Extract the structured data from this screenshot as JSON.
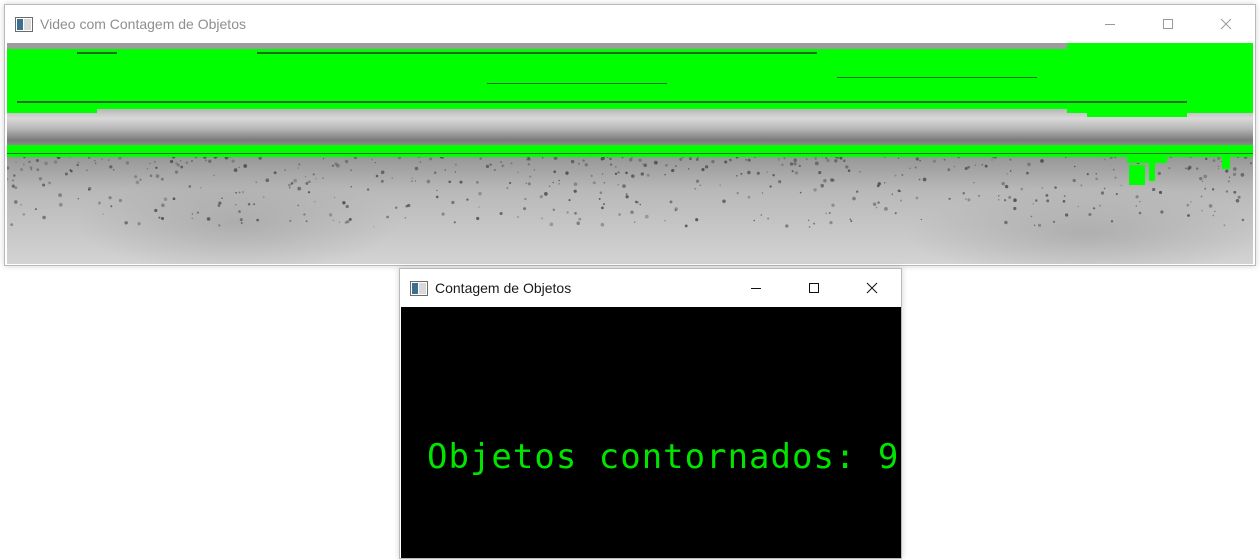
{
  "video_window": {
    "title": "Video com Contagem de Objetos",
    "state": "inactive",
    "app_icon": "opencv-window-icon",
    "controls": [
      "minimize-icon",
      "maximize-icon",
      "close-icon"
    ]
  },
  "count_window": {
    "title": "Contagem de Objetos",
    "state": "active",
    "app_icon": "opencv-window-icon",
    "controls": [
      "minimize-icon",
      "maximize-icon",
      "close-icon"
    ],
    "count_text": "Objetos contornados: 9",
    "count_value": 9,
    "text_color": "#00e400",
    "background_color": "#000000"
  },
  "overlay": {
    "contour_color": "#00ff00"
  }
}
